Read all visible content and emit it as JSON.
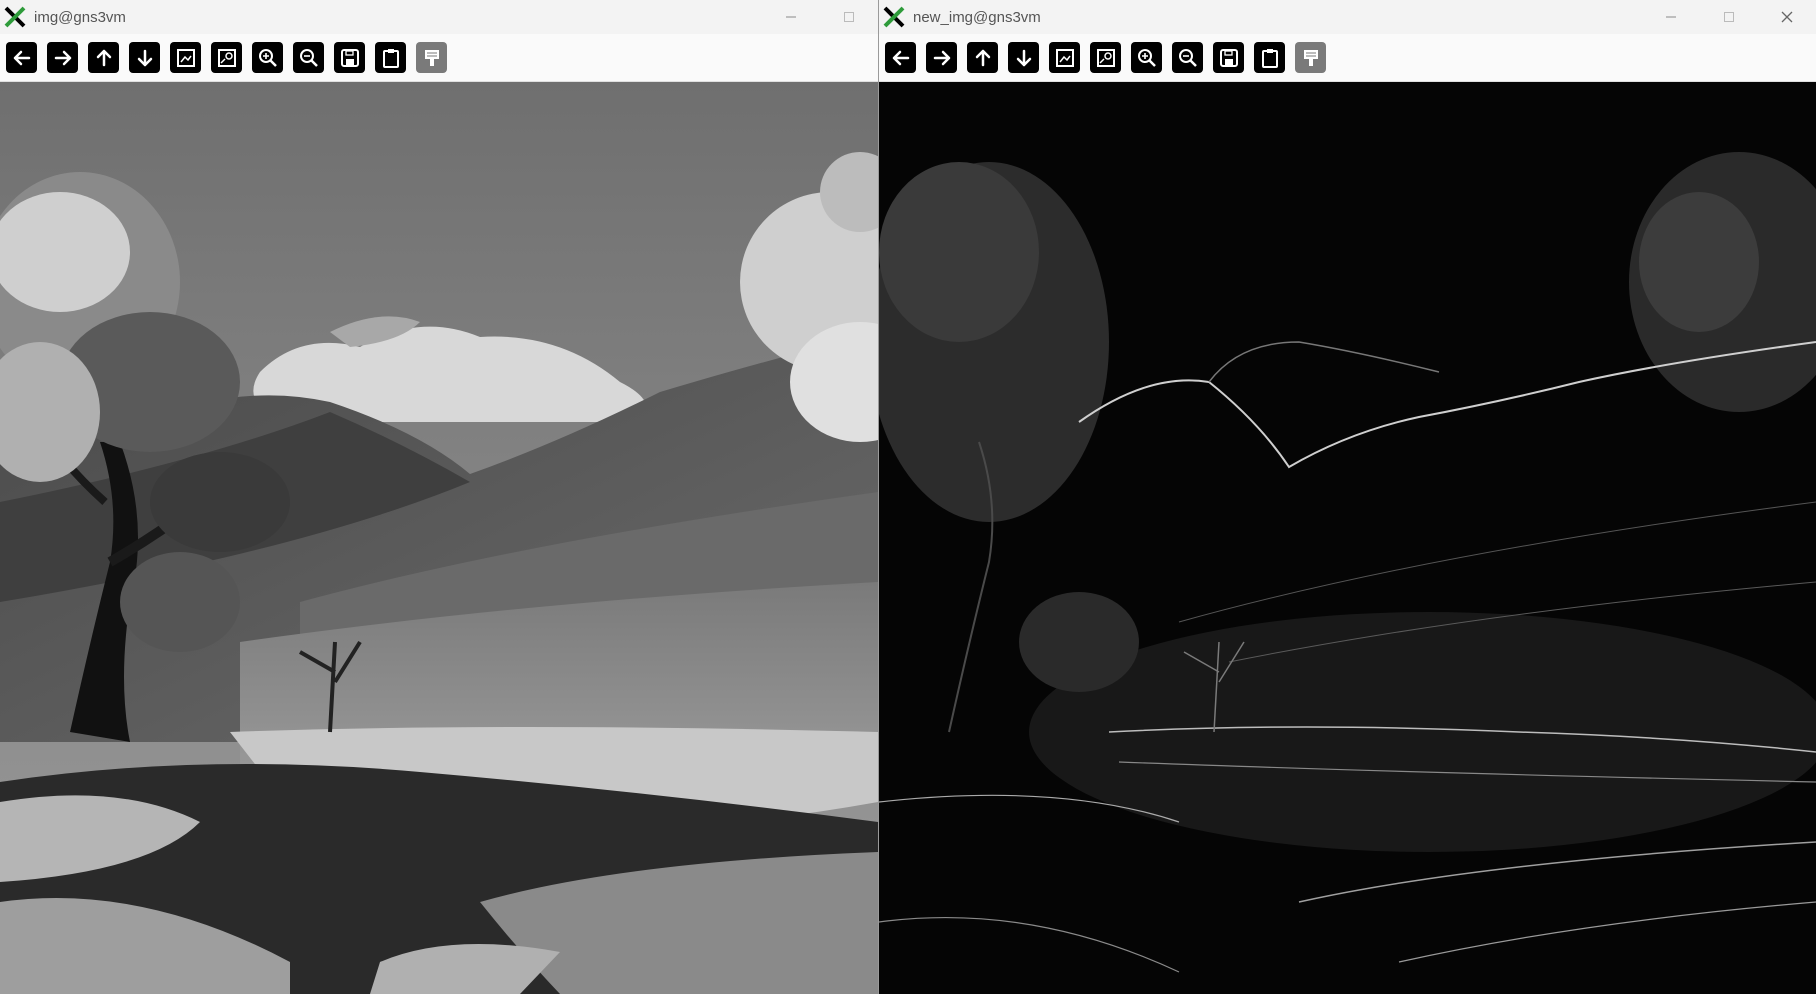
{
  "windows": [
    {
      "title": "img@gns3vm",
      "view": "original-grayscale",
      "controls": [
        "minimize",
        "maximize"
      ]
    },
    {
      "title": "new_img@gns3vm",
      "view": "edge-detected",
      "controls": [
        "minimize",
        "maximize",
        "close"
      ]
    }
  ],
  "toolbar": {
    "buttons": [
      {
        "name": "back-icon"
      },
      {
        "name": "forward-icon"
      },
      {
        "name": "pan-up-icon"
      },
      {
        "name": "pan-down-icon"
      },
      {
        "name": "image-icon"
      },
      {
        "name": "image-settings-icon"
      },
      {
        "name": "zoom-in-icon"
      },
      {
        "name": "zoom-out-icon"
      },
      {
        "name": "save-icon"
      },
      {
        "name": "clipboard-icon"
      },
      {
        "name": "paint-icon",
        "disabled": true
      }
    ]
  },
  "colors": {
    "titlebar": "#f3f3f3",
    "toolbar": "#fafafa",
    "button": "#000000",
    "button_disabled": "#7a7a7a",
    "app_icon_green": "#2e9b3a"
  }
}
